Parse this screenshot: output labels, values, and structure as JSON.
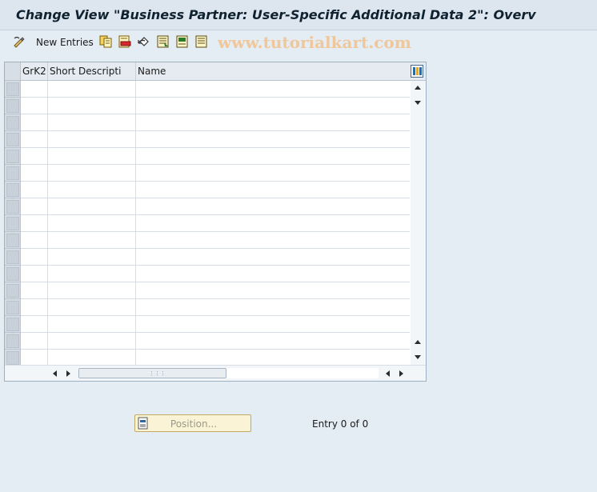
{
  "title": "Change View \"Business Partner: User-Specific Additional Data 2\": Overv",
  "toolbar": {
    "new_entries_label": "New Entries",
    "icons": [
      "glasses-pen-icon",
      "copy-icon",
      "delete-icon",
      "undo-icon",
      "select-all-icon",
      "select-block-icon",
      "deselect-all-icon"
    ]
  },
  "watermark": "www.tutorialkart.com",
  "table": {
    "columns": [
      "GrK2",
      "Short Descripti",
      "Name"
    ],
    "rows": []
  },
  "position_button": {
    "label": "Position..."
  },
  "entry_status": "Entry 0 of 0"
}
